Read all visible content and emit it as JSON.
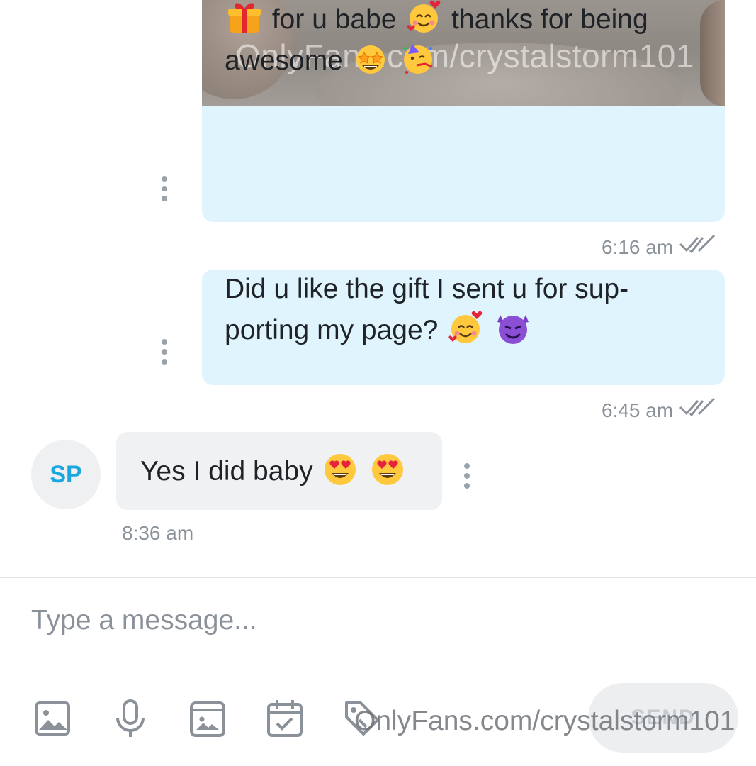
{
  "media": {
    "watermark": "OnlyFans.com/crystalstorm101"
  },
  "messages": [
    {
      "direction": "outgoing",
      "lines": [
        "for u babe",
        "thanks for being",
        "awesome"
      ],
      "emojis": [
        "wrapped-gift",
        "smiling-face-with-hearts",
        "star-struck",
        "partying-face"
      ],
      "time": "6:16 am",
      "status_icon": "double-check-icon"
    },
    {
      "direction": "outgoing",
      "lines": [
        "Did u like the gift I sent u for sup-",
        "porting my page?"
      ],
      "emojis": [
        "smiling-face-with-hearts",
        "smiling-face-with-horns"
      ],
      "time": "6:45 am",
      "status_icon": "double-check-icon"
    },
    {
      "direction": "incoming",
      "sender_initials": "SP",
      "text": "Yes I did baby",
      "emojis": [
        "heart-eyes",
        "heart-eyes"
      ],
      "time": "8:36 am"
    }
  ],
  "composer": {
    "placeholder": "Type a message...",
    "tools": [
      "image-icon",
      "microphone-icon",
      "vault-icon",
      "calendar-icon",
      "price-tag-icon"
    ],
    "send_label": "SEND"
  },
  "footer_watermark": "OnlyFans.com/crystalstorm101",
  "colors": {
    "outgoing_bubble": "#dff4fd",
    "incoming_bubble": "#eff1f3",
    "avatar_initials": "#1aa7e0",
    "meta_text": "#8a9199"
  }
}
